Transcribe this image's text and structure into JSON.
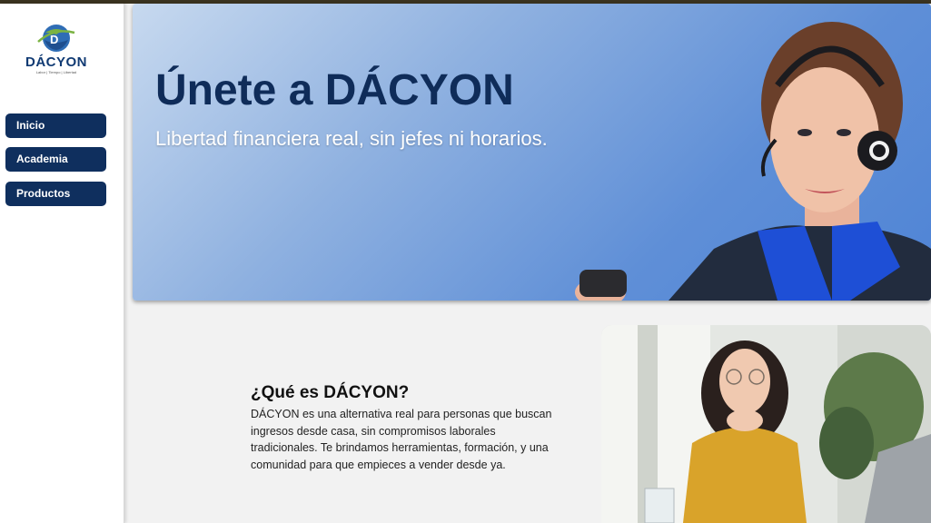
{
  "brand": {
    "name": "DÁCYON",
    "tagline": "Labor | Tiempo | Libertad"
  },
  "sidebar": {
    "items": [
      {
        "label": "Inicio"
      },
      {
        "label": "Academia"
      },
      {
        "label": "Productos"
      }
    ]
  },
  "hero": {
    "title": "Únete a DÁCYON",
    "subtitle": "Libertad financiera real, sin jefes ni horarios."
  },
  "about": {
    "title": "¿Qué es DÁCYON?",
    "text": "DÁCYON es una alternativa real para personas que buscan ingresos desde casa, sin compromisos laborales tradicionales. Te brindamos herramientas, formación, y una comunidad para que empieces a vender desde ya."
  },
  "colors": {
    "navy": "#0f2f5e",
    "hero_blue": "#5f8fd7",
    "accent_green": "#7bb342"
  }
}
